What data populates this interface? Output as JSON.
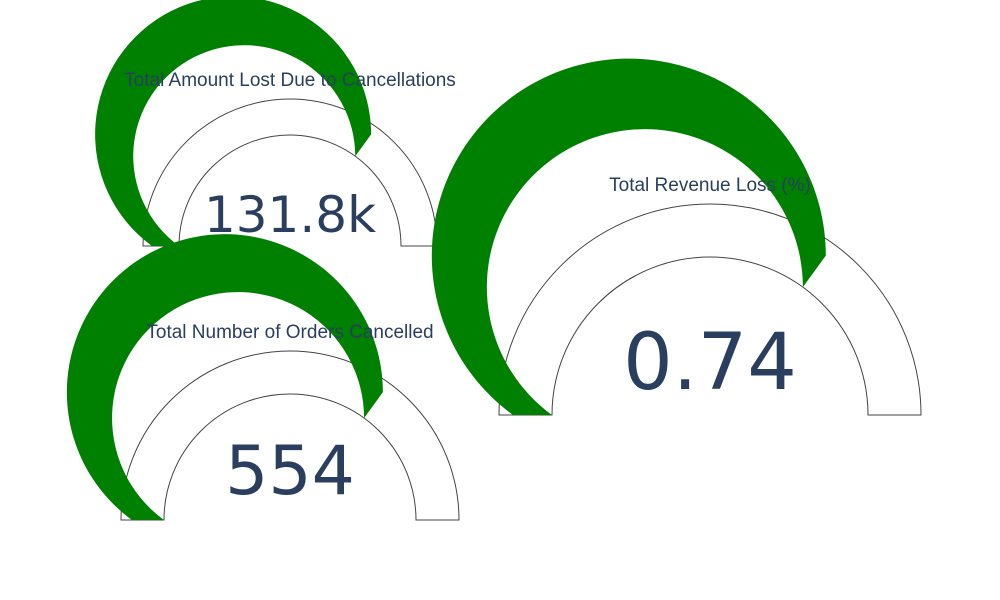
{
  "colors": {
    "bar": "#008000",
    "outline": "#444444",
    "text": "#2a3f5f",
    "background": "#ffffff"
  },
  "chart_data": [
    {
      "type": "gauge",
      "title": "Total Amount Lost Due to Cancellations",
      "display_value": "131.8k",
      "bar_fraction": 0.7
    },
    {
      "type": "gauge",
      "title": "Total Number of Orders Cancelled",
      "display_value": "554",
      "bar_fraction": 0.7
    },
    {
      "type": "gauge",
      "title": "Total Revenue Loss (%)",
      "display_value": "0.74",
      "bar_fraction": 0.7
    }
  ]
}
